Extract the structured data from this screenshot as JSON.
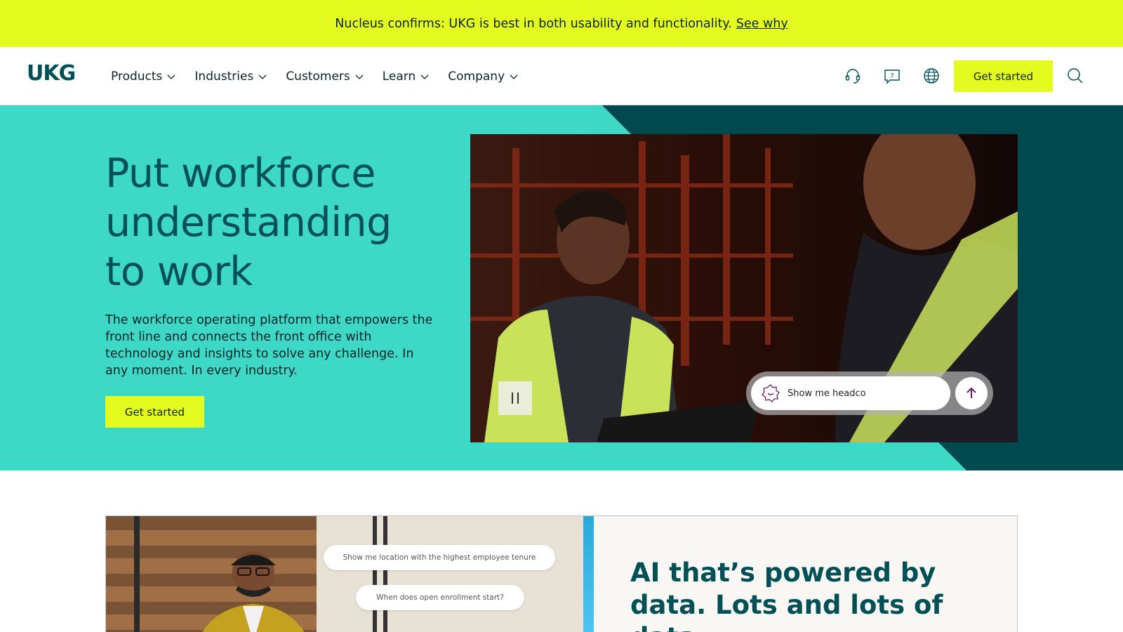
{
  "banner": {
    "text": "Nucleus confirms: UKG is best in both usability and functionality.",
    "link": "See why"
  },
  "header": {
    "logo": "UKG",
    "nav": [
      {
        "label": "Products"
      },
      {
        "label": "Industries"
      },
      {
        "label": "Customers"
      },
      {
        "label": "Learn"
      },
      {
        "label": "Company"
      }
    ],
    "icons": [
      "headset-icon",
      "help-chat-icon",
      "globe-icon",
      "search-icon"
    ],
    "cta": "Get started"
  },
  "hero": {
    "title": "Put workforce understanding to work",
    "subtitle": "The workforce operating platform that empowers the front line and connects the front office with technology and insights to solve any challenge. In any moment. In every industry.",
    "cta": "Get started",
    "video": {
      "prompt_text": "Show me headco",
      "pause_icon": "pause-icon",
      "send_icon": "arrow-up-icon"
    }
  },
  "ai_section": {
    "heading": "AI that’s powered by data. Lots and lots of data.",
    "bubbles": [
      "Show me location with the highest employee tenure",
      "When does open enrollment start?"
    ]
  },
  "colors": {
    "accent_yellow": "#e4fb20",
    "hero_teal": "#3dd8c6",
    "dark_teal": "#004a4f",
    "brand_text": "#005056"
  }
}
